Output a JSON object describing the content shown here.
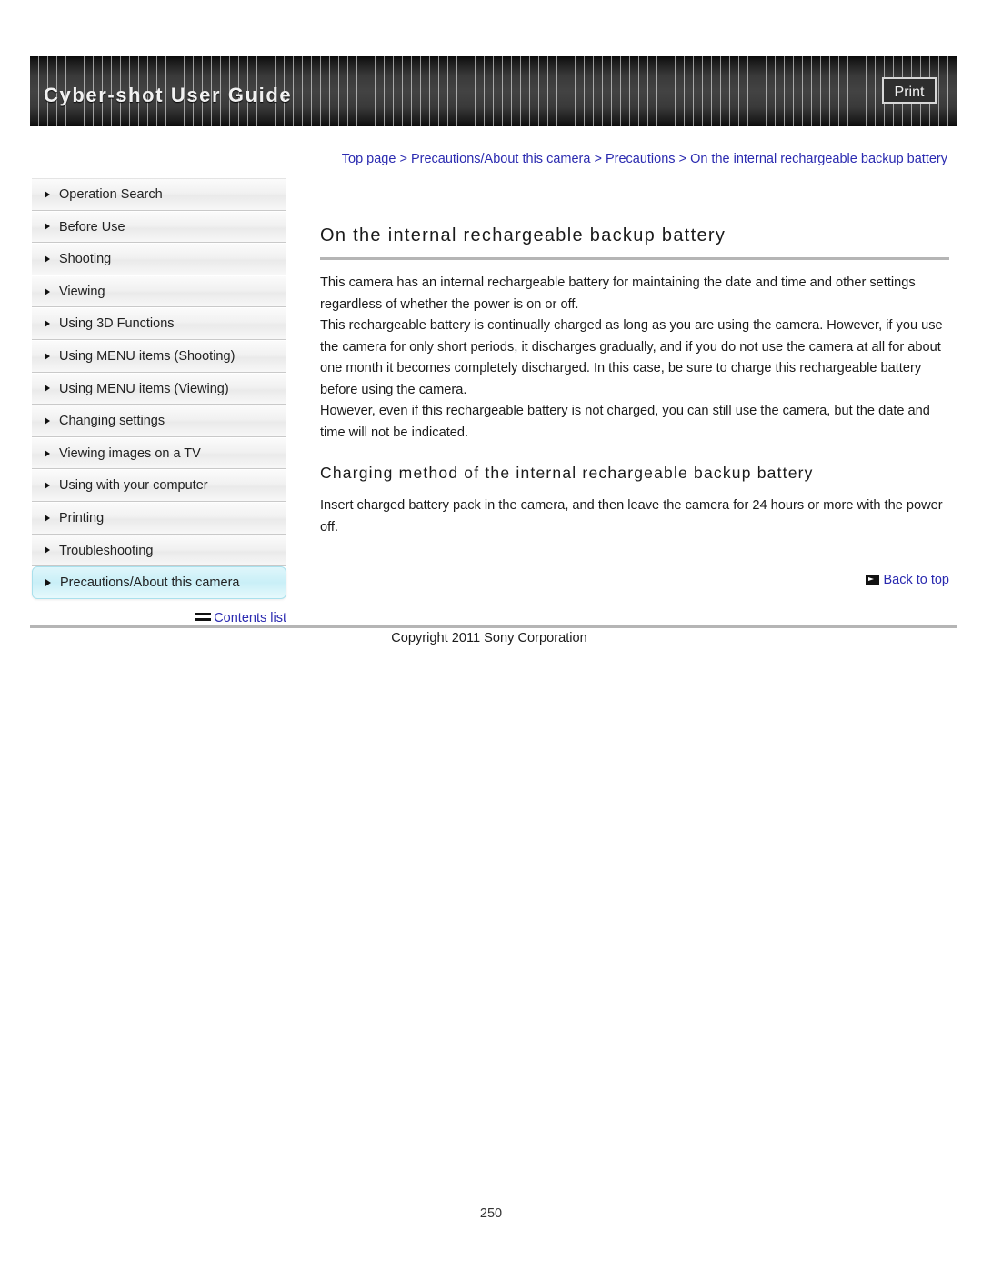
{
  "header": {
    "title": "Cyber-shot User Guide",
    "print_label": "Print"
  },
  "breadcrumb": {
    "items": [
      "Top page",
      "Precautions/About this camera",
      "Precautions",
      "On the internal rechargeable backup battery"
    ],
    "separator": ">"
  },
  "sidebar": {
    "items": [
      {
        "label": "Operation Search",
        "active": false
      },
      {
        "label": "Before Use",
        "active": false
      },
      {
        "label": "Shooting",
        "active": false
      },
      {
        "label": "Viewing",
        "active": false
      },
      {
        "label": "Using 3D Functions",
        "active": false
      },
      {
        "label": "Using MENU items (Shooting)",
        "active": false
      },
      {
        "label": "Using MENU items (Viewing)",
        "active": false
      },
      {
        "label": "Changing settings",
        "active": false
      },
      {
        "label": "Viewing images on a TV",
        "active": false
      },
      {
        "label": "Using with your computer",
        "active": false
      },
      {
        "label": "Printing",
        "active": false
      },
      {
        "label": "Troubleshooting",
        "active": false
      },
      {
        "label": "Precautions/About this camera",
        "active": true
      }
    ],
    "contents_list_label": "Contents list"
  },
  "main": {
    "heading": "On the internal rechargeable backup battery",
    "paragraphs": [
      "This camera has an internal rechargeable battery for maintaining the date and time and other settings regardless of whether the power is on or off.",
      "This rechargeable battery is continually charged as long as you are using the camera. However, if you use the camera for only short periods, it discharges gradually, and if you do not use the camera at all for about one month it becomes completely discharged. In this case, be sure to charge this rechargeable battery before using the camera.",
      "However, even if this rechargeable battery is not charged, you can still use the camera, but the date and time will not be indicated."
    ],
    "sub_heading": "Charging method of the internal rechargeable backup battery",
    "sub_paragraph": "Insert charged battery pack in the camera, and then leave the camera for 24 hours or more with the power off.",
    "back_to_top_label": "Back to top"
  },
  "footer": {
    "copyright": "Copyright 2011 Sony Corporation",
    "page_number": "250"
  },
  "colors": {
    "link": "#2a2ab0",
    "active_item": "#c9eff7",
    "header_bg": "#3a3a3a",
    "rule": "#b5b5b5"
  }
}
